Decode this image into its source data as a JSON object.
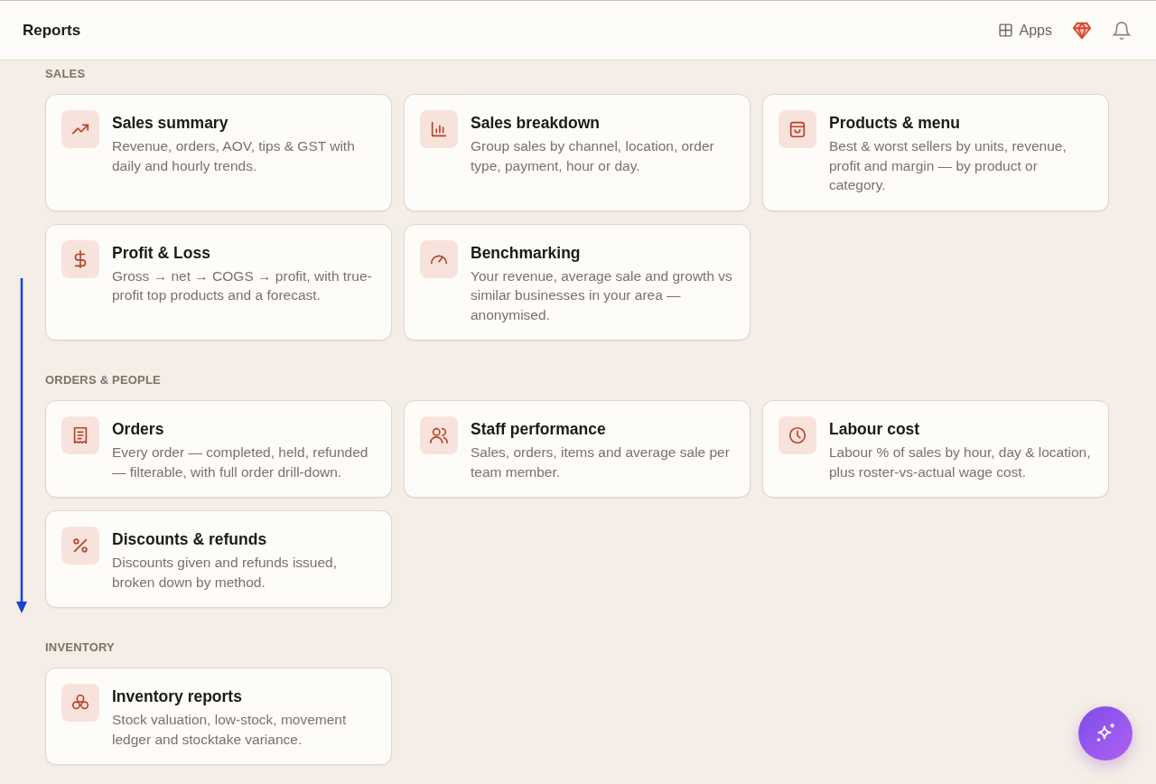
{
  "header": {
    "title": "Reports",
    "apps_label": "Apps"
  },
  "sections": [
    {
      "label": "SALES",
      "cards": [
        {
          "kind": "trend",
          "title": "Sales summary",
          "description": "Revenue, orders, AOV, tips & GST with daily and hourly trends."
        },
        {
          "kind": "bars",
          "title": "Sales breakdown",
          "description": "Group sales by channel, location, order type, payment, hour or day."
        },
        {
          "kind": "bag",
          "title": "Products & menu",
          "description": "Best & worst sellers by units, revenue, profit and margin — by product or category."
        },
        {
          "kind": "dollar",
          "title": "Profit & Loss",
          "description": "Gross → net → COGS → profit, with true-profit top products and a forecast."
        },
        {
          "kind": "gauge",
          "title": "Benchmarking",
          "description": "Your revenue, average sale and growth vs similar businesses in your area — anonymised."
        }
      ]
    },
    {
      "label": "ORDERS & PEOPLE",
      "cards": [
        {
          "kind": "receipt",
          "title": "Orders",
          "description": "Every order — completed, held, refunded — filterable, with full order drill-down."
        },
        {
          "kind": "people",
          "title": "Staff performance",
          "description": "Sales, orders, items and average sale per team member."
        },
        {
          "kind": "clock",
          "title": "Labour cost",
          "description": "Labour % of sales by hour, day & location, plus roster-vs-actual wage cost."
        },
        {
          "kind": "percent",
          "title": "Discounts & refunds",
          "description": "Discounts given and refunds issued, broken down by method."
        }
      ]
    },
    {
      "label": "INVENTORY",
      "cards": [
        {
          "kind": "boxes",
          "title": "Inventory reports",
          "description": "Stock valuation, low-stock, movement ledger and stocktake variance."
        }
      ]
    }
  ]
}
